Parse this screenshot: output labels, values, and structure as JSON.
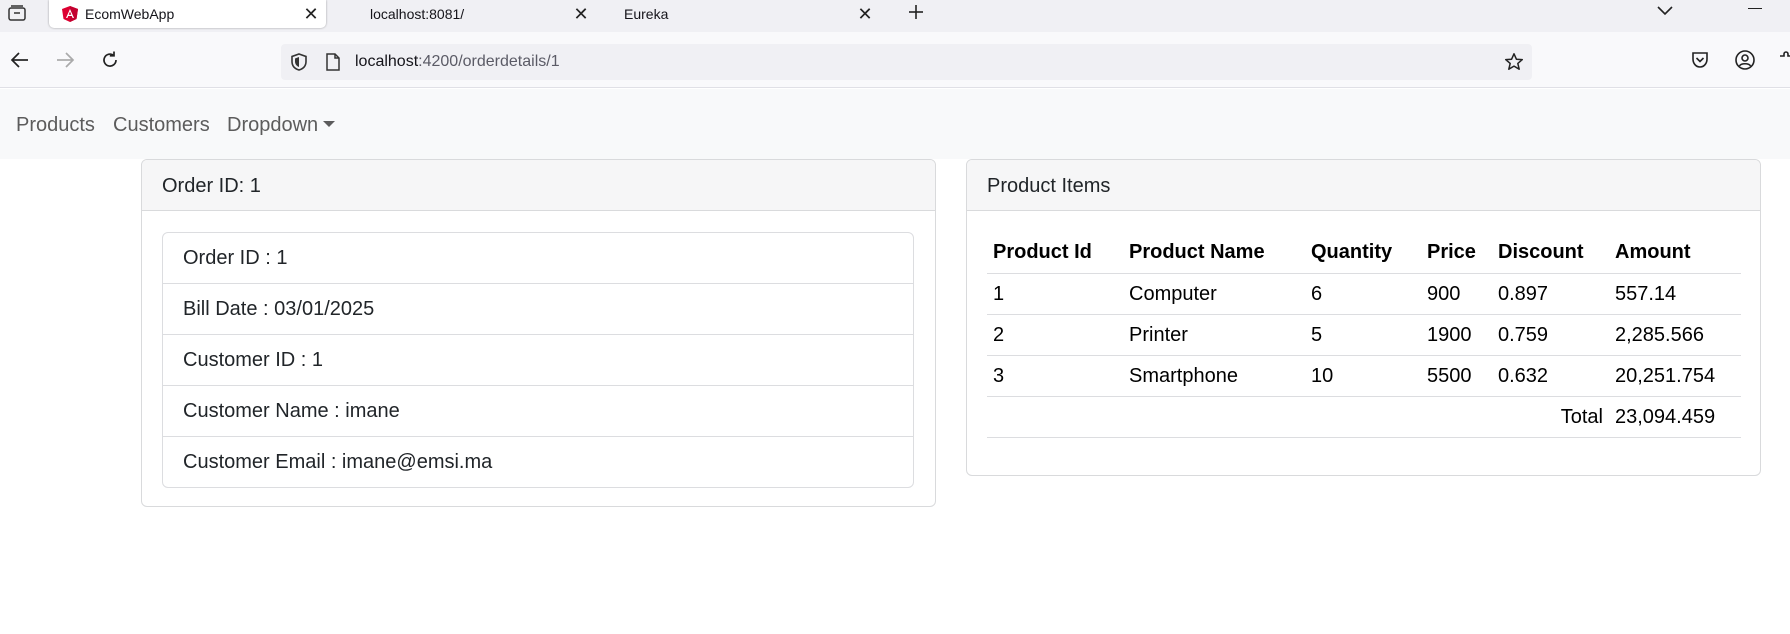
{
  "browser": {
    "tabs": [
      {
        "title": "EcomWebApp",
        "active": true,
        "favicon": "angular-icon"
      },
      {
        "title": "localhost:8081/",
        "active": false
      },
      {
        "title": "Eureka",
        "active": false
      }
    ],
    "url": {
      "host": "localhost",
      "path": ":4200/orderdetails/1"
    }
  },
  "nav": {
    "products": "Products",
    "customers": "Customers",
    "dropdown": "Dropdown"
  },
  "order_card": {
    "header": "Order ID: 1",
    "items": [
      "Order ID : 1",
      "Bill Date : 03/01/2025",
      "Customer ID : 1",
      "Customer Name : imane",
      "Customer Email : imane@emsi.ma"
    ]
  },
  "product_card": {
    "header": "Product Items",
    "columns": [
      "Product Id",
      "Product Name",
      "Quantity",
      "Price",
      "Discount",
      "Amount"
    ],
    "rows": [
      [
        "1",
        "Computer",
        "6",
        "900",
        "0.897",
        "557.14"
      ],
      [
        "2",
        "Printer",
        "5",
        "1900",
        "0.759",
        "2,285.566"
      ],
      [
        "3",
        "Smartphone",
        "10",
        "5500",
        "0.632",
        "20,251.754"
      ]
    ],
    "total_label": "Total",
    "total_value": "23,094.459"
  },
  "colors": {
    "angular": "#dd0031",
    "navbar_bg": "#f8f9fa"
  }
}
